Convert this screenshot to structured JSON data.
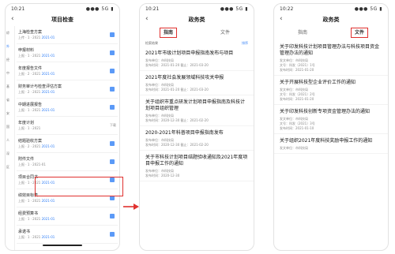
{
  "screens": [
    {
      "time": "10:21",
      "signal": "●●● 5G ▮",
      "nav_title": "项目检查",
      "back_icon": "chevron-left-icon",
      "side_items": [
        "综",
        "外",
        "经",
        "中",
        "基",
        "省",
        "安",
        "国",
        "人",
        "深",
        "区"
      ],
      "items": [
        {
          "title": "上海检查方案",
          "sub": "上传 · 1 · 2021",
          "sub_blue": "2021-01"
        },
        {
          "title": "申报材料",
          "sub": "上报 · 1 · 2021",
          "sub_blue": "2021-01"
        },
        {
          "title": "年度报告文件",
          "sub": "上报 · 2 · 2021",
          "sub_blue": "2021-01"
        },
        {
          "title": "财务审计与检查评估方案",
          "sub": "上报 · 2 · 2021",
          "sub_blue": "2021-01"
        },
        {
          "title": "中期进展报告",
          "sub": "上报 · 1 · 2021",
          "sub_blue": "2021-01"
        },
        {
          "title": "年度计划",
          "sub": "上报 · 1 · 2021",
          "sub_blue": "",
          "tag": "下载"
        },
        {
          "title": "结题验收方案",
          "sub": "上报 · 2 · 2021",
          "sub_blue": "2021-01"
        },
        {
          "title": "附件文件",
          "sub": "上报 · 1 · 2021-01",
          "sub_blue": ""
        },
        {
          "title": "项目合同书",
          "sub": "上报 · 1 · 2021",
          "sub_blue": "2021-01"
        },
        {
          "title": "绩效目标表",
          "sub": "上报 · 1 · 2021",
          "sub_blue": "2021-01"
        },
        {
          "title": "经费预算书",
          "sub": "上报 · 1 · 2021",
          "sub_blue": "2021-01"
        },
        {
          "title": "承诺书",
          "sub": "上报 · 1 · 2021",
          "sub_blue": "2021-01"
        }
      ]
    },
    {
      "time": "10:21",
      "signal": "●●● 5G ▮",
      "nav_title": "政务类",
      "tabs": [
        "指南",
        "文件"
      ],
      "sub_left": "检索结果",
      "sub_right": "排序",
      "articles": [
        {
          "title": "2021年市级计划项目申报指南发布与项目",
          "m1": "发布单位：市科技局",
          "m2": "发布时间：2021-01-20  截止：2021-03-20"
        },
        {
          "title": "2021年度社会发展领域科技攻关申报",
          "m1": "发布单位：市科技局",
          "m2": "发布时间：2021-01-20  截止：2021-03-20"
        },
        {
          "title": "关于组织市重点研发计划项目申报指南及科技计划项目组织管理",
          "m1": "发布单位：市科技局",
          "m2": "发布时间：2020-12-30  截止：2021-02-20"
        },
        {
          "title": "2020-2021年科普项目申报指南发布",
          "m1": "发布单位：市科技局",
          "m2": "发布时间：2020-12-30  截止：2021-02-20"
        },
        {
          "title": "关于市科技计划项目结题验收通知及2021年度项目申报工作的通知",
          "m1": "发布单位：市科技局",
          "m2": "发布时间：2020-12-30"
        }
      ]
    },
    {
      "time": "10:22",
      "signal": "●●● 5G ▮",
      "nav_title": "政务类",
      "tabs": [
        "指南",
        "文件"
      ],
      "articles": [
        {
          "title": "关于印发科技计划项目管理办法与科技项目资金管理办法的通知",
          "m1": "发文单位：市科技局",
          "m2": "文号：科发〔2021〕1号",
          "m3": "发布时间：2021-01-20"
        },
        {
          "title": "关于开展科技型企业评价工作的通知",
          "m1": "发文单位：市科技局",
          "m2": "文号：科发〔2021〕2号",
          "m3": "发布时间：2021-01-20"
        },
        {
          "title": "关于印发科技创新专项资金管理办法的通知",
          "m1": "发文单位：市科技局",
          "m2": "文号：科发〔2021〕3号",
          "m3": "发布时间：2021-01-10"
        },
        {
          "title": "关于组织2021年度科技奖励申报工作的通知",
          "m1": "发文单位：市科技局",
          "m2": "",
          "m3": ""
        }
      ]
    }
  ],
  "colors": {
    "accent": "#2f7ef6",
    "highlight": "#e0312f"
  }
}
